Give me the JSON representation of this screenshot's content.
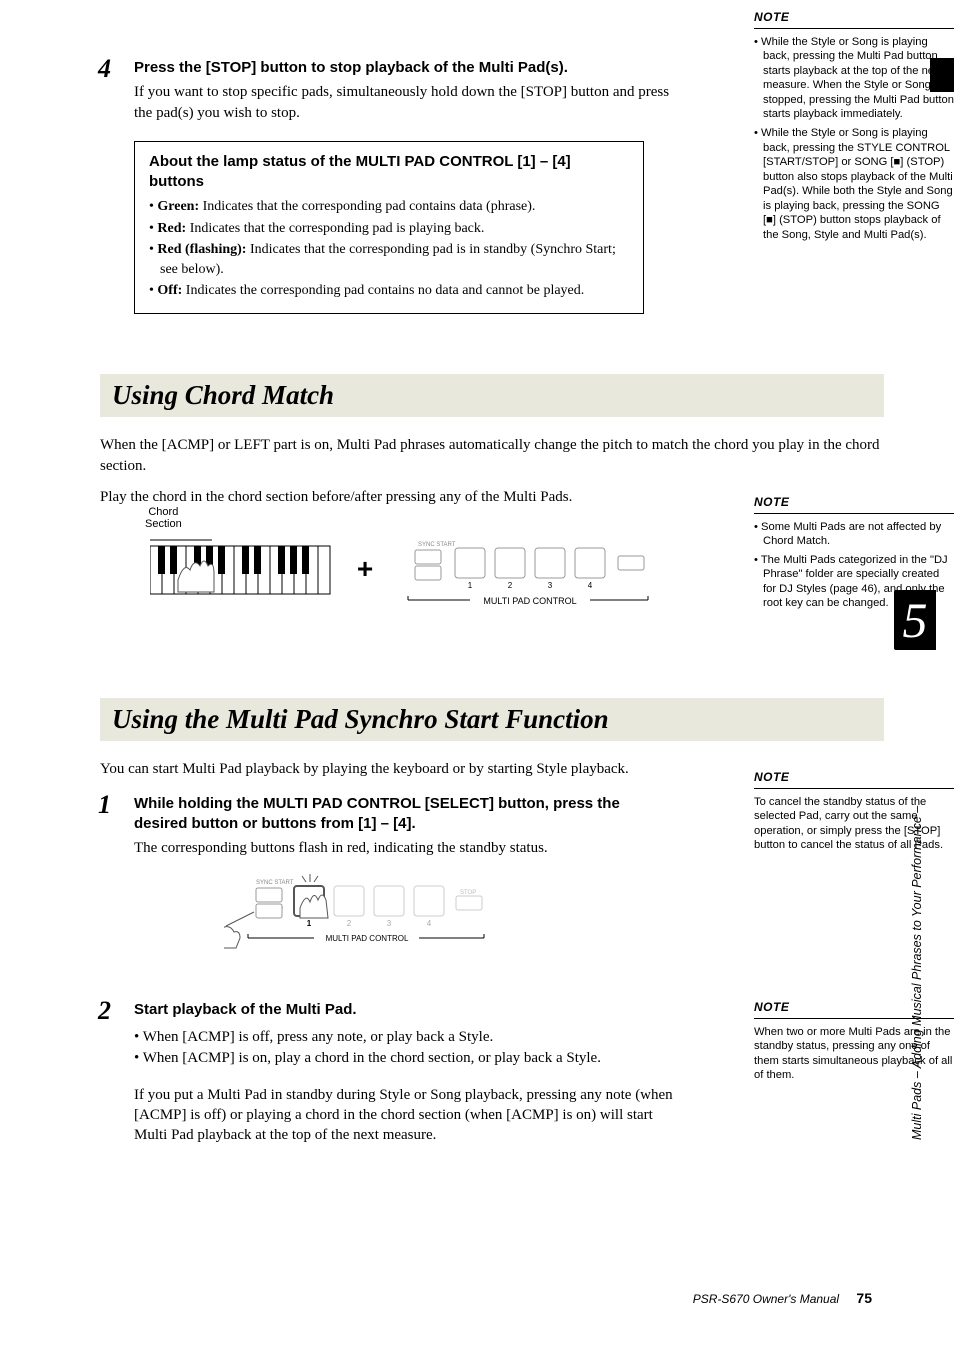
{
  "step4": {
    "num": "4",
    "heading": "Press the [STOP] button to stop playback of the Multi Pad(s).",
    "body": "If you want to stop specific pads, simultaneously hold down the [STOP] button and press the pad(s) you wish to stop."
  },
  "inset": {
    "title": "About the lamp status of the MULTI PAD CONTROL [1] – [4] buttons",
    "items": [
      {
        "label": "Green:",
        "text": " Indicates that the corresponding pad contains data (phrase)."
      },
      {
        "label": "Red:",
        "text": " Indicates that the corresponding pad is playing back."
      },
      {
        "label": "Red (flashing):",
        "text": " Indicates that the corresponding pad is in standby (Synchro Start; see below)."
      },
      {
        "label": "Off:",
        "text": " Indicates the corresponding pad contains no data and cannot be played."
      }
    ]
  },
  "note1": {
    "title": "NOTE",
    "items": [
      "While the Style or Song is playing back, pressing the Multi Pad button starts playback at the top of the next measure. When the Style or Song is stopped, pressing the Multi Pad button starts playback immediately.",
      "While the Style or Song is playing back, pressing the STYLE CONTROL [START/STOP] or SONG [■] (STOP) button also stops playback of the Multi Pad(s). While both the Style and Song is playing back, pressing the SONG [■] (STOP) button stops playback of the Song, Style and Multi Pad(s)."
    ]
  },
  "chordMatch": {
    "title": "Using Chord Match",
    "intro1": "When the [ACMP] or LEFT part is on, Multi Pad phrases automatically change the pitch to match the chord you play in the chord section.",
    "intro2": "Play the chord in the chord section before/after pressing any of the Multi Pads.",
    "chordLabel": "Chord\nSection",
    "multiPadLabel": "MULTI PAD CONTROL"
  },
  "note2": {
    "title": "NOTE",
    "items": [
      "Some Multi Pads are not affected by Chord Match.",
      "The Multi Pads categorized in the \"DJ Phrase\" folder are specially created for DJ Styles (page 46), and only the root key can be changed."
    ]
  },
  "synchro": {
    "title": "Using the Multi Pad Synchro Start Function",
    "intro": "You can start Multi Pad playback by playing the keyboard or by starting Style playback."
  },
  "step1": {
    "num": "1",
    "heading": "While holding the MULTI PAD CONTROL [SELECT] button, press the desired button or buttons from [1] – [4].",
    "body": "The corresponding buttons flash in red, indicating the standby status.",
    "diagramLabel": "MULTI PAD CONTROL"
  },
  "note3": {
    "title": "NOTE",
    "body": "To cancel the standby status of the selected Pad, carry out the same operation, or simply press the [STOP] button to cancel the status of all Pads."
  },
  "step2": {
    "num": "2",
    "heading": "Start playback of the Multi Pad.",
    "bullets": [
      "When [ACMP] is off, press any note, or play back a Style.",
      "When [ACMP] is on, play a chord in the chord section, or play back a Style."
    ],
    "paragraph": "If you put a Multi Pad in standby during Style or Song playback, pressing any note (when [ACMP] is off) or playing a chord in the chord section (when [ACMP] is on) will start Multi Pad playback at the top of the next measure."
  },
  "note4": {
    "title": "NOTE",
    "body": "When two or more Multi Pads are in the standby status, pressing any one of them starts simultaneous playback of all of them."
  },
  "side": {
    "chapter": "5",
    "text": "Multi Pads – Adding Musical Phrases to Your Performance –"
  },
  "footer": {
    "doc": "PSR-S670 Owner's Manual",
    "page": "75"
  }
}
